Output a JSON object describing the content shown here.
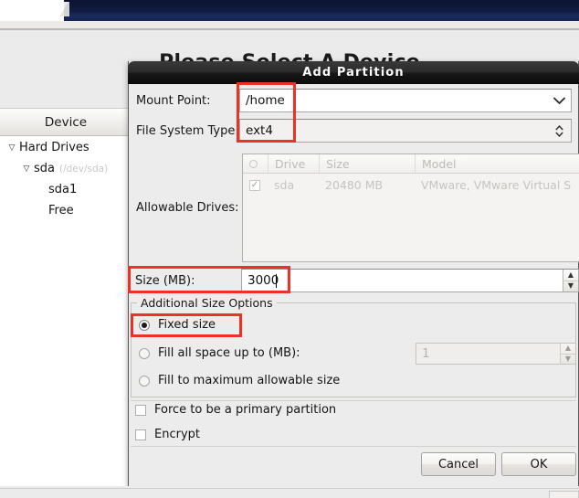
{
  "background": {
    "page_title": "Please Select A Device",
    "tree_header": "Device",
    "tree": [
      {
        "label": "Hard Drives",
        "sub": "",
        "indent": 0,
        "twisty": "▽"
      },
      {
        "label": "sda",
        "sub": "(/dev/sda)",
        "indent": 1,
        "twisty": "▽"
      },
      {
        "label": "sda1",
        "sub": "",
        "indent": 2,
        "twisty": ""
      },
      {
        "label": "Free",
        "sub": "",
        "indent": 2,
        "twisty": ""
      }
    ]
  },
  "dialog": {
    "title": "Add Partition",
    "mount_point": {
      "label": "Mount Point:",
      "value": "/home",
      "icon": "chevron-down-icon"
    },
    "file_system_type": {
      "label": "File System Type",
      "value": "ext4",
      "icon": "spinner-updown-icon"
    },
    "allowable_drives": {
      "label": "Allowable Drives:",
      "columns": [
        "",
        "Drive",
        "Size",
        "Model"
      ],
      "rows": [
        {
          "checked": "✓",
          "drive": "sda",
          "size": "20480 MB",
          "model": "VMware, VMware Virtual S"
        }
      ]
    },
    "size": {
      "label": "Size (MB):",
      "value": "3000"
    },
    "additional_size_options": {
      "legend": "Additional Size Options",
      "options": [
        {
          "label": "Fixed size",
          "selected": true
        },
        {
          "label": "Fill all space up to (MB):",
          "selected": false,
          "value": "1"
        },
        {
          "label": "Fill to maximum allowable size",
          "selected": false
        }
      ]
    },
    "checkboxes": [
      {
        "label": "Force to be a primary partition",
        "checked": false
      },
      {
        "label": "Encrypt",
        "checked": false
      }
    ],
    "buttons": {
      "cancel": "Cancel",
      "ok": "OK"
    }
  },
  "annotations": {
    "highlight_color": "#ee3124",
    "boxes": [
      "mount-point-and-fs-type",
      "size-mb-row",
      "fixed-size-radio"
    ]
  }
}
